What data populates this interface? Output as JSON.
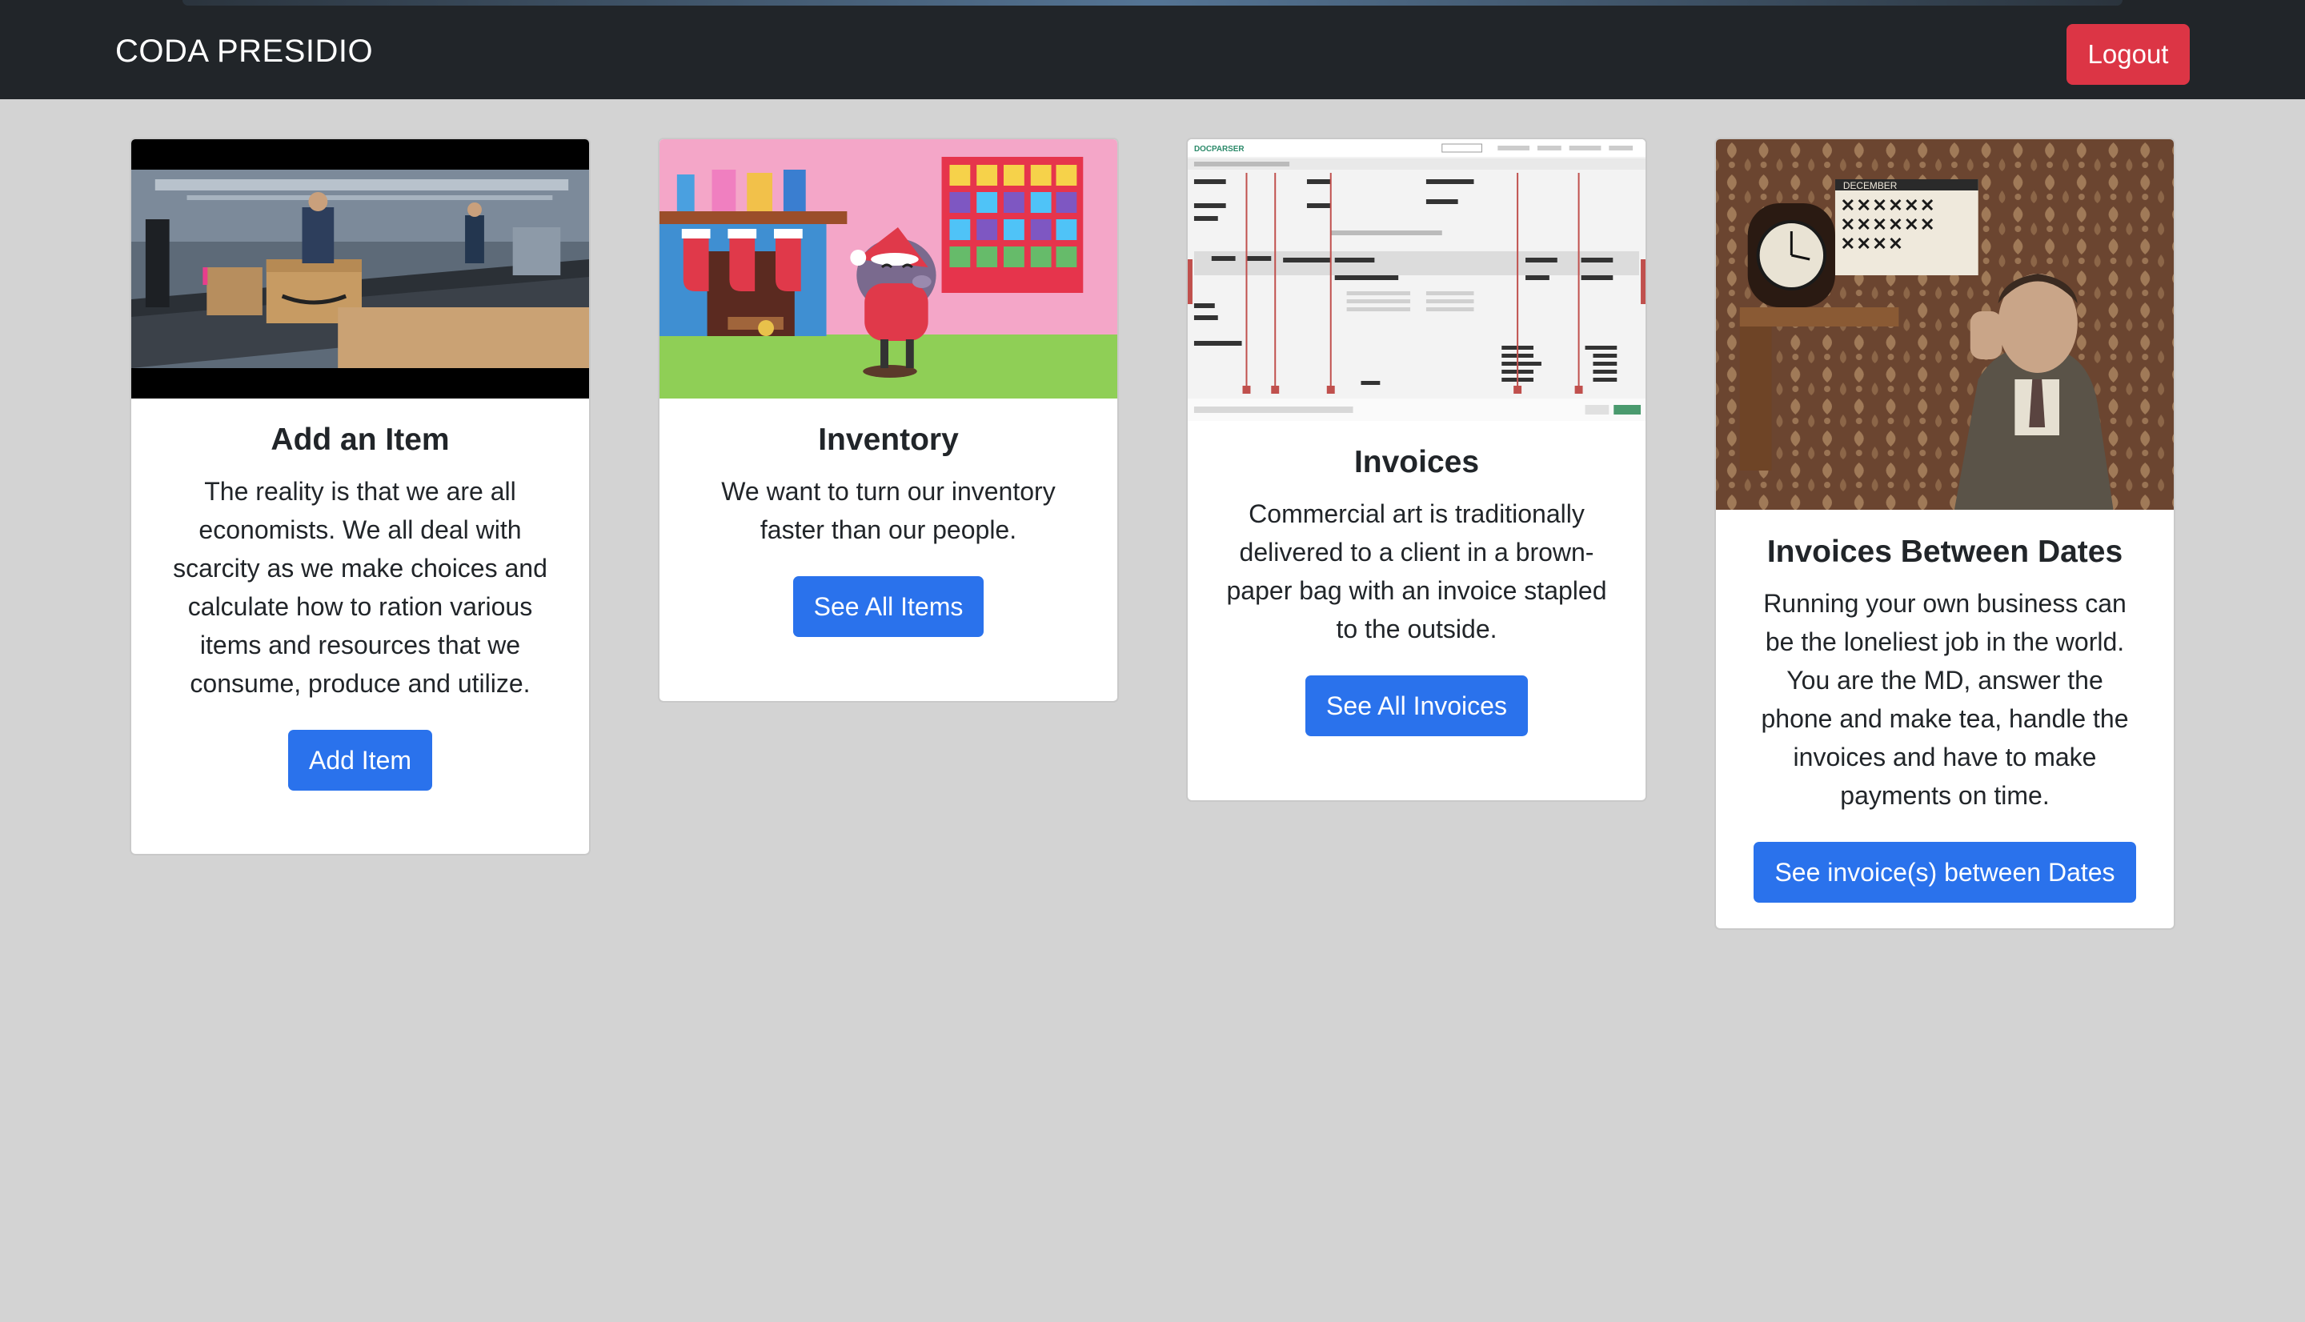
{
  "navbar": {
    "brand": "CODA PRESIDIO",
    "logout_label": "Logout"
  },
  "cards": [
    {
      "title": "Add an Item",
      "text": "The reality is that we are all economists. We all deal with scarcity as we make choices and calculate how to ration various items and resources that we consume, produce and utilize.",
      "button_label": "Add Item",
      "image": "warehouse-conveyor-photo"
    },
    {
      "title": "Inventory",
      "text": "We want to turn our inventory faster than our people.",
      "button_label": "See All Items",
      "image": "holiday-cartoon-illustration"
    },
    {
      "title": "Invoices",
      "text": "Commercial art is traditionally delivered to a client in a brown-paper bag with an invoice stapled to the outside.",
      "button_label": "See All Invoices",
      "image": "document-parser-screenshot",
      "image_text": {
        "logo": "DOCPARSER"
      }
    },
    {
      "title": "Invoices Between Dates",
      "text": "Running your own business can be the loneliest job in the world. You are the MD, answer the phone and make tea, handle the invoices and have to make payments on time.",
      "button_label": "See invoice(s) between Dates",
      "image": "calendar-wall-photo",
      "image_text": {
        "calendar_month": "DECEMBER"
      }
    }
  ],
  "colors": {
    "navbar_bg": "#212529",
    "page_bg": "#d3d3d3",
    "primary": "#2a72ec",
    "danger": "#dc3545"
  }
}
